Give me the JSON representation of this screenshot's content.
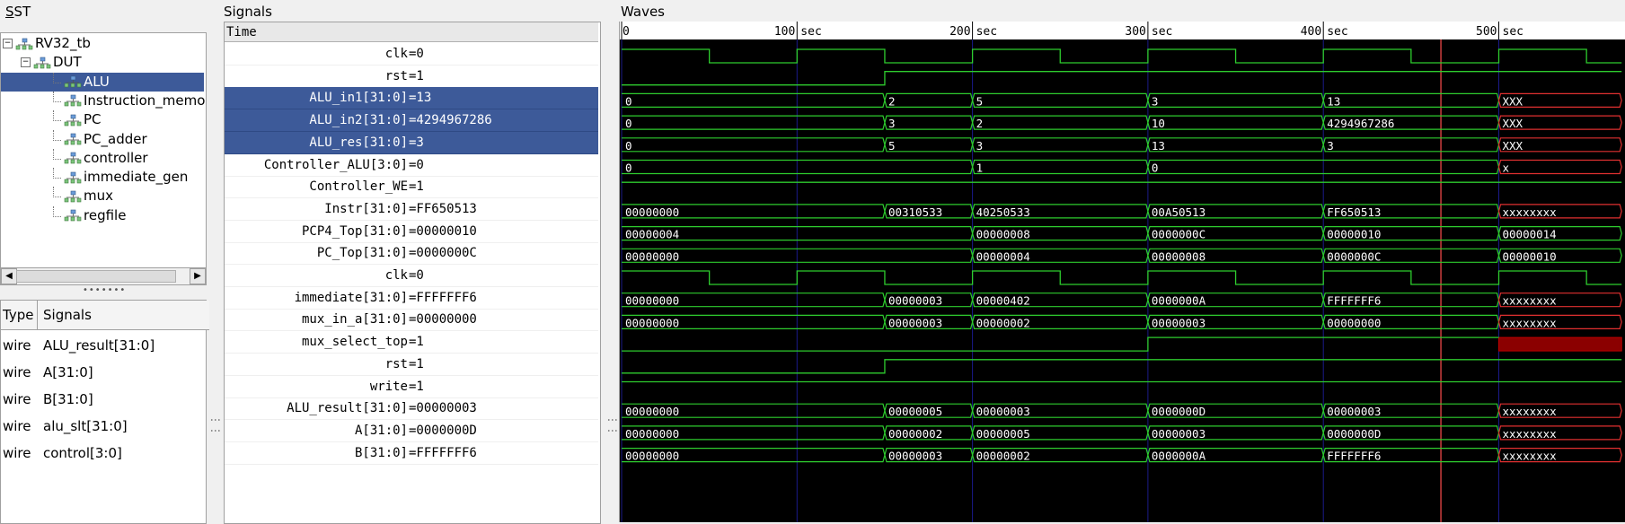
{
  "panes": {
    "sst_title": "SST",
    "signals_title": "Signals",
    "waves_title": "Waves"
  },
  "tree": [
    {
      "label": "RV32_tb",
      "indent": 0,
      "expander": "−",
      "selected": false
    },
    {
      "label": "DUT",
      "indent": 1,
      "expander": "−",
      "selected": false
    },
    {
      "label": "ALU",
      "indent": 2,
      "selected": true
    },
    {
      "label": "Instruction_memor",
      "indent": 2,
      "selected": false
    },
    {
      "label": "PC",
      "indent": 2,
      "selected": false
    },
    {
      "label": "PC_adder",
      "indent": 2,
      "selected": false
    },
    {
      "label": "controller",
      "indent": 2,
      "selected": false
    },
    {
      "label": "immediate_gen",
      "indent": 2,
      "selected": false
    },
    {
      "label": "mux",
      "indent": 2,
      "selected": false
    },
    {
      "label": "regfile",
      "indent": 2,
      "selected": false
    }
  ],
  "type_table": {
    "headers": [
      "Type",
      "Signals"
    ],
    "rows": [
      {
        "type": "wire",
        "signal": "ALU_result[31:0]"
      },
      {
        "type": "wire",
        "signal": "A[31:0]"
      },
      {
        "type": "wire",
        "signal": "B[31:0]"
      },
      {
        "type": "wire",
        "signal": "alu_slt[31:0]"
      },
      {
        "type": "wire",
        "signal": "control[3:0]"
      }
    ]
  },
  "signals_header": "Time",
  "signals": [
    {
      "name": "clk",
      "value": "=0",
      "selected": false
    },
    {
      "name": "rst",
      "value": "=1",
      "selected": false
    },
    {
      "name": "ALU_in1[31:0]",
      "value": "=13",
      "selected": true
    },
    {
      "name": "ALU_in2[31:0]",
      "value": "=4294967286",
      "selected": true
    },
    {
      "name": "ALU_res[31:0]",
      "value": "=3",
      "selected": true
    },
    {
      "name": "Controller_ALU[3:0]",
      "value": "=0",
      "selected": false
    },
    {
      "name": "Controller_WE",
      "value": "=1",
      "selected": false
    },
    {
      "name": "Instr[31:0]",
      "value": "=FF650513",
      "selected": false
    },
    {
      "name": "PCP4_Top[31:0]",
      "value": "=00000010",
      "selected": false
    },
    {
      "name": "PC_Top[31:0]",
      "value": "=0000000C",
      "selected": false
    },
    {
      "name": "clk",
      "value": "=0",
      "selected": false
    },
    {
      "name": "immediate[31:0]",
      "value": "=FFFFFFF6",
      "selected": false
    },
    {
      "name": "mux_in_a[31:0]",
      "value": "=00000000",
      "selected": false
    },
    {
      "name": "mux_select_top",
      "value": "=1",
      "selected": false
    },
    {
      "name": "rst",
      "value": "=1",
      "selected": false
    },
    {
      "name": "write",
      "value": "=1",
      "selected": false
    },
    {
      "name": "ALU_result[31:0]",
      "value": "=00000003",
      "selected": false
    },
    {
      "name": "A[31:0]",
      "value": "=0000000D",
      "selected": false
    },
    {
      "name": "B[31:0]",
      "value": "=FFFFFFF6",
      "selected": false
    }
  ],
  "waves": {
    "colors": {
      "background": "#000000",
      "trace": "#2ecc2e",
      "grid": "#1a1a8a",
      "marker": "#ff4d4d",
      "xfill": "#8b0000",
      "text": "#ffffff"
    },
    "time_unit": "sec",
    "time_max": 570,
    "tick_labels": [
      0,
      100,
      200,
      300,
      400,
      500
    ],
    "cursor_time": 467,
    "clock": {
      "period": 100,
      "first_high": 0,
      "high_len": 50
    },
    "traces": [
      {
        "kind": "clock"
      },
      {
        "kind": "bit",
        "changes": [
          [
            0,
            0
          ],
          [
            150,
            1
          ]
        ]
      },
      {
        "kind": "bus",
        "segments": [
          [
            0,
            "0"
          ],
          [
            150,
            "2"
          ],
          [
            200,
            "5"
          ],
          [
            300,
            "3"
          ],
          [
            400,
            "13"
          ],
          [
            500,
            "XXX"
          ]
        ]
      },
      {
        "kind": "bus",
        "segments": [
          [
            0,
            "0"
          ],
          [
            150,
            "3"
          ],
          [
            200,
            "2"
          ],
          [
            300,
            "10"
          ],
          [
            400,
            "4294967286"
          ],
          [
            500,
            "XXX"
          ]
        ]
      },
      {
        "kind": "bus",
        "segments": [
          [
            0,
            "0"
          ],
          [
            150,
            "5"
          ],
          [
            200,
            "3"
          ],
          [
            300,
            "13"
          ],
          [
            400,
            "3"
          ],
          [
            500,
            "XXX"
          ]
        ]
      },
      {
        "kind": "bus",
        "segments": [
          [
            0,
            "0"
          ],
          [
            200,
            "1"
          ],
          [
            300,
            "0"
          ],
          [
            500,
            "x"
          ]
        ]
      },
      {
        "kind": "bit",
        "changes": [
          [
            0,
            1
          ]
        ]
      },
      {
        "kind": "bus",
        "segments": [
          [
            0,
            "00000000"
          ],
          [
            150,
            "00310533"
          ],
          [
            200,
            "40250533"
          ],
          [
            300,
            "00A50513"
          ],
          [
            400,
            "FF650513"
          ],
          [
            500,
            "xxxxxxxx"
          ]
        ]
      },
      {
        "kind": "bus",
        "segments": [
          [
            0,
            "00000004"
          ],
          [
            200,
            "00000008"
          ],
          [
            300,
            "0000000C"
          ],
          [
            400,
            "00000010"
          ],
          [
            500,
            "00000014"
          ]
        ]
      },
      {
        "kind": "bus",
        "segments": [
          [
            0,
            "00000000"
          ],
          [
            200,
            "00000004"
          ],
          [
            300,
            "00000008"
          ],
          [
            400,
            "0000000C"
          ],
          [
            500,
            "00000010"
          ]
        ]
      },
      {
        "kind": "clock"
      },
      {
        "kind": "bus",
        "segments": [
          [
            0,
            "00000000"
          ],
          [
            150,
            "00000003"
          ],
          [
            200,
            "00000402"
          ],
          [
            300,
            "0000000A"
          ],
          [
            400,
            "FFFFFFF6"
          ],
          [
            500,
            "xxxxxxxx"
          ]
        ]
      },
      {
        "kind": "bus",
        "segments": [
          [
            0,
            "00000000"
          ],
          [
            150,
            "00000003"
          ],
          [
            200,
            "00000002"
          ],
          [
            300,
            "00000003"
          ],
          [
            400,
            "00000000"
          ],
          [
            500,
            "xxxxxxxx"
          ]
        ]
      },
      {
        "kind": "bit",
        "changes": [
          [
            0,
            0
          ],
          [
            300,
            1
          ],
          [
            500,
            "x"
          ]
        ]
      },
      {
        "kind": "bit",
        "changes": [
          [
            0,
            0
          ],
          [
            150,
            1
          ]
        ]
      },
      {
        "kind": "bit",
        "changes": [
          [
            0,
            1
          ]
        ]
      },
      {
        "kind": "bus",
        "segments": [
          [
            0,
            "00000000"
          ],
          [
            150,
            "00000005"
          ],
          [
            200,
            "00000003"
          ],
          [
            300,
            "0000000D"
          ],
          [
            400,
            "00000003"
          ],
          [
            500,
            "xxxxxxxx"
          ]
        ]
      },
      {
        "kind": "bus",
        "segments": [
          [
            0,
            "00000000"
          ],
          [
            150,
            "00000002"
          ],
          [
            200,
            "00000005"
          ],
          [
            300,
            "00000003"
          ],
          [
            400,
            "0000000D"
          ],
          [
            500,
            "xxxxxxxx"
          ]
        ]
      },
      {
        "kind": "bus",
        "segments": [
          [
            0,
            "00000000"
          ],
          [
            150,
            "00000003"
          ],
          [
            200,
            "00000002"
          ],
          [
            300,
            "0000000A"
          ],
          [
            400,
            "FFFFFFF6"
          ],
          [
            500,
            "xxxxxxxx"
          ]
        ]
      }
    ]
  }
}
